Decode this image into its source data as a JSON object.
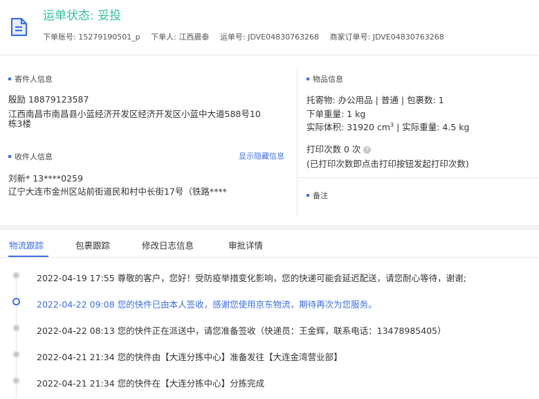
{
  "header": {
    "status_title": "运单状态: 妥投",
    "order_account": "下单账号: 15279190501_p",
    "order_person": "下单人: 江西晨泰",
    "waybill_no": "运单号: JDVE04830763268",
    "merchant_order_no": "商家订单号: JDVE04830763268"
  },
  "sender": {
    "title": "寄件人信息",
    "name_phone": "殷励   18879123587",
    "address_line1": "江西南昌市南昌县小蓝经济开发区经济开发区小蓝中大道588号10",
    "address_line2": "栋3楼"
  },
  "receiver": {
    "title": "收件人信息",
    "toggle_label": "显示隐藏信息",
    "name_phone": "刘新*    13****0259",
    "address": "辽宁大连市金州区站前街道民和村中长街17号（铁路****"
  },
  "goods": {
    "title": "物品信息",
    "line1": "托寄物:  办公用品 | 普通 | 包裹数:  1",
    "line2": "下单重量:  1 kg",
    "volume_prefix": "实际体积:   31920 cm",
    "volume_sup": "3",
    "volume_suffix": " | 实际重量:   4.5 kg",
    "print_count": "打印次数   0 次",
    "print_note": "(已打印次数即点击打印按钮发起打印次数)"
  },
  "remark": {
    "title": "备注"
  },
  "tabs": [
    "物流跟踪",
    "包裹跟踪",
    "修改日志信息",
    "审批详情"
  ],
  "events": [
    {
      "text": "2022-04-19 17:55  尊敬的客户，您好！受防疫举措变化影响，您的快递可能会延迟配送，请您耐心等待，谢谢;",
      "current": false
    },
    {
      "text": "2022-04-22 09:08  您的快件已由本人签收，感谢您使用京东物流，期待再次为您服务。",
      "current": true
    },
    {
      "text": "2022-04-22 08:13  您的快件正在派送中，请您准备签收（快递员：王金辉，联系电话：13478985405）",
      "current": false
    },
    {
      "text": "2022-04-21 21:34  您的快件由【大连分拣中心】准备发往【大连金湾营业部】",
      "current": false
    },
    {
      "text": "2022-04-21 21:34  您的快件在【大连分拣中心】分拣完成",
      "current": false
    }
  ],
  "icons": {
    "document": "document-icon",
    "help": "help-icon"
  },
  "colors": {
    "accent": "#3c6fe0",
    "status": "#2fc0a0"
  }
}
